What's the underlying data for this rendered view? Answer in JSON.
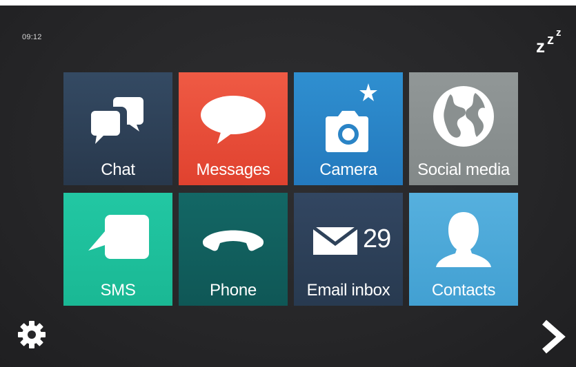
{
  "status": {
    "time": "09:12",
    "sleep_icon": "sleep-zzz-icon"
  },
  "tiles": [
    {
      "label": "Chat",
      "icon": "chat-bubbles-icon",
      "color": "#2f4259"
    },
    {
      "label": "Messages",
      "icon": "speech-bubble-icon",
      "color": "#e54b38"
    },
    {
      "label": "Camera",
      "icon": "camera-icon",
      "color": "#2c87c8"
    },
    {
      "label": "Social media",
      "icon": "globe-icon",
      "color": "#8a9090"
    },
    {
      "label": "SMS",
      "icon": "sms-bubble-icon",
      "color": "#1fbf9c"
    },
    {
      "label": "Phone",
      "icon": "phone-handset-icon",
      "color": "#115f5e"
    },
    {
      "label": "Email inbox",
      "icon": "envelope-icon",
      "color": "#2f4259",
      "count": "29"
    },
    {
      "label": "Contacts",
      "icon": "person-icon",
      "color": "#4aa4d3"
    }
  ],
  "footer": {
    "settings_icon": "gear-icon",
    "next_icon": "chevron-right-icon"
  },
  "colors": {
    "background": "#262628",
    "text": "#ffffff"
  }
}
